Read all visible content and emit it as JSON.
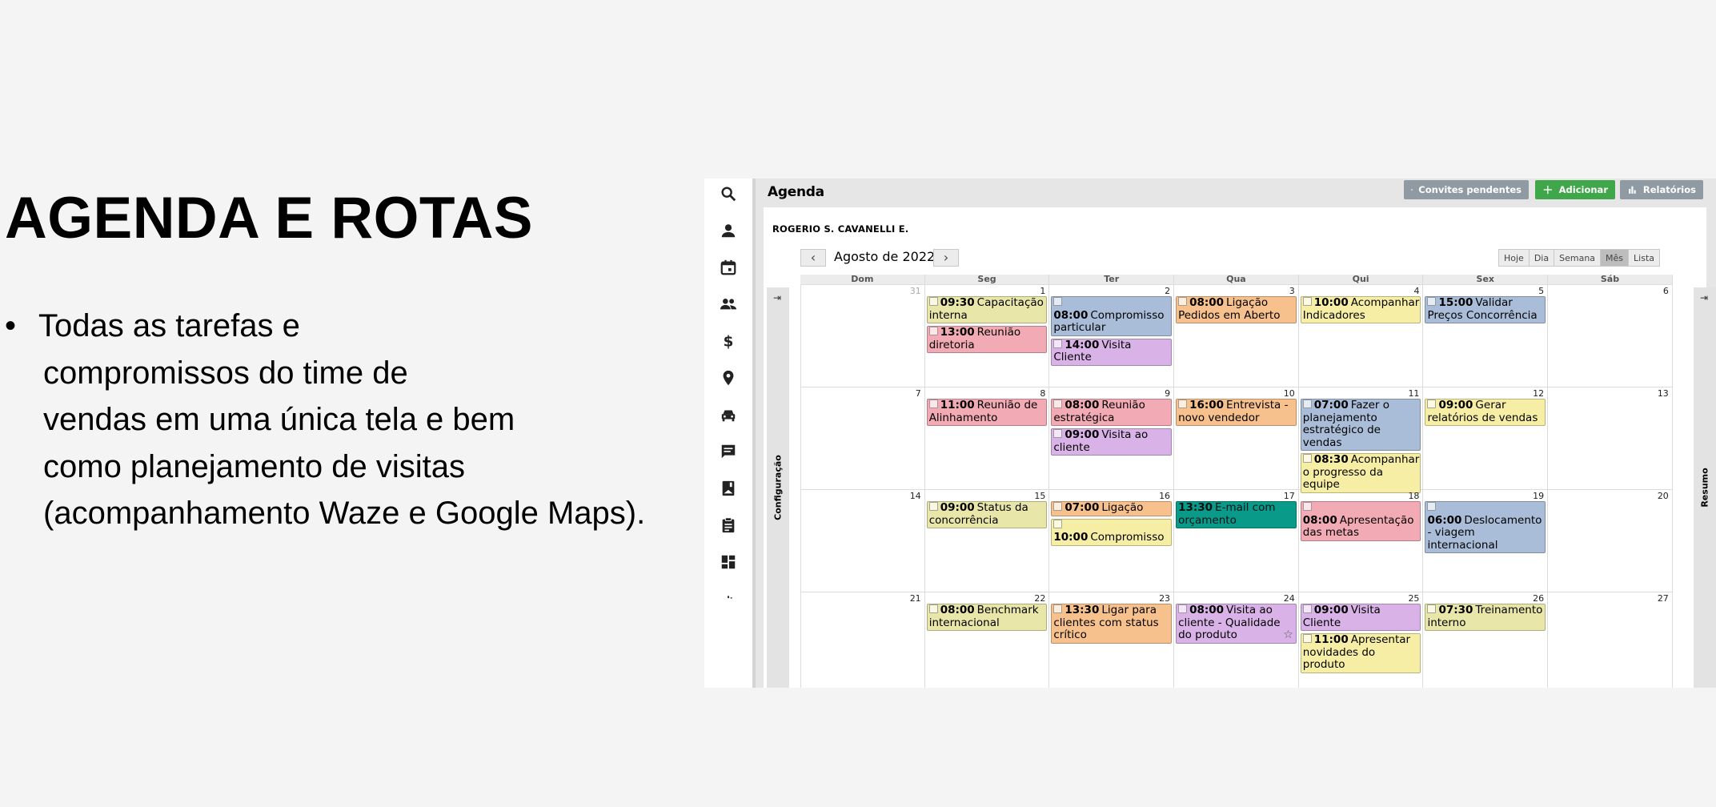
{
  "slide": {
    "title": "AGENDA E ROTAS",
    "bullet_marker": "•",
    "bullet_lines": [
      "Todas as tarefas e",
      "compromissos do time de",
      "vendas em uma única tela e bem",
      "como planejamento de visitas",
      "(acompanhamento Waze e Google Maps)."
    ]
  },
  "app": {
    "page_title": "Agenda",
    "buttons": {
      "invites": "Convites pendentes",
      "add": "Adicionar",
      "reports": "Relatórios"
    },
    "user_name": "ROGERIO S. CAVANELLI E.",
    "nav_prev": "‹",
    "nav_next": "›",
    "month_label": "Agosto de 2022",
    "views": [
      "Hoje",
      "Dia",
      "Semana",
      "Mês",
      "Lista"
    ],
    "active_view": "Mês",
    "left_panel_label": "Configuração",
    "right_panel_label": "Resumo",
    "sidebar_icons": [
      "search-icon",
      "user-icon",
      "calendar-icon",
      "team-icon",
      "dollar-icon",
      "map-pin-icon",
      "car-icon",
      "chat-icon",
      "contacts-book-icon",
      "clipboard-icon",
      "dashboard-icon",
      "more-icon"
    ],
    "colors": {
      "yellow": "#f7eea6",
      "olive": "#e8e6a8",
      "blue": "#a9bcd8",
      "pink": "#f2aab4",
      "purple": "#d9b3e8",
      "orange": "#f7c18e",
      "teal": "#0a9a8a",
      "green_button": "#3fa64a",
      "gray_button": "#8f9aa3"
    },
    "calendar": {
      "weekdays": [
        "Dom",
        "Seg",
        "Ter",
        "Qua",
        "Qui",
        "Sex",
        "Sáb"
      ],
      "weeks": [
        [
          {
            "day": "31",
            "muted": true,
            "events": []
          },
          {
            "day": "1",
            "events": [
              {
                "time": "09:30",
                "title": "Capacitação interna",
                "color": "olive"
              },
              {
                "time": "13:00",
                "title": "Reunião diretoria",
                "color": "pink"
              }
            ]
          },
          {
            "day": "2",
            "events": [
              {
                "time": "08:00",
                "title": "Compromisso particular",
                "color": "blue"
              },
              {
                "time": "14:00",
                "title": "Visita Cliente",
                "color": "purple"
              }
            ]
          },
          {
            "day": "3",
            "events": [
              {
                "time": "08:00",
                "title": "Ligação Pedidos em Aberto",
                "color": "orange"
              }
            ]
          },
          {
            "day": "4",
            "events": [
              {
                "time": "10:00",
                "title": "Acompanhar Indicadores",
                "color": "yellow"
              }
            ]
          },
          {
            "day": "5",
            "events": [
              {
                "time": "15:00",
                "title": "Validar Preços Concorrência",
                "color": "blue"
              }
            ]
          },
          {
            "day": "6",
            "events": []
          }
        ],
        [
          {
            "day": "7",
            "events": []
          },
          {
            "day": "8",
            "events": [
              {
                "time": "11:00",
                "title": "Reunião de Alinhamento",
                "color": "pink"
              }
            ]
          },
          {
            "day": "9",
            "events": [
              {
                "time": "08:00",
                "title": "Reunião estratégica",
                "color": "pink"
              },
              {
                "time": "09:00",
                "title": "Visita ao cliente",
                "color": "purple"
              }
            ]
          },
          {
            "day": "10",
            "events": [
              {
                "time": "16:00",
                "title": "Entrevista - novo vendedor",
                "color": "orange"
              }
            ]
          },
          {
            "day": "11",
            "events": [
              {
                "time": "07:00",
                "title": "Fazer o planejamento estratégico de vendas",
                "color": "blue"
              },
              {
                "time": "08:30",
                "title": "Acompanhar o progresso da equipe",
                "color": "yellow"
              }
            ]
          },
          {
            "day": "12",
            "events": [
              {
                "time": "09:00",
                "title": "Gerar relatórios de vendas",
                "color": "yellow"
              }
            ]
          },
          {
            "day": "13",
            "events": []
          }
        ],
        [
          {
            "day": "14",
            "events": []
          },
          {
            "day": "15",
            "events": [
              {
                "time": "09:00",
                "title": "Status da concorrência",
                "color": "olive"
              }
            ]
          },
          {
            "day": "16",
            "events": [
              {
                "time": "07:00",
                "title": "Ligação",
                "color": "orange"
              },
              {
                "time": "10:00",
                "title": "Compromisso",
                "color": "yellow"
              }
            ]
          },
          {
            "day": "17",
            "events": [
              {
                "time": "13:30",
                "title": "E-mail com orçamento",
                "color": "teal"
              }
            ]
          },
          {
            "day": "18",
            "events": [
              {
                "time": "08:00",
                "title": "Apresentação das metas",
                "color": "pink"
              }
            ]
          },
          {
            "day": "19",
            "events": [
              {
                "time": "06:00",
                "title": "Deslocamento - viagem internacional",
                "color": "blue"
              }
            ]
          },
          {
            "day": "20",
            "events": []
          }
        ],
        [
          {
            "day": "21",
            "events": []
          },
          {
            "day": "22",
            "events": [
              {
                "time": "08:00",
                "title": "Benchmark internacional",
                "color": "olive"
              }
            ]
          },
          {
            "day": "23",
            "events": [
              {
                "time": "13:30",
                "title": "Ligar para clientes com status crítico",
                "color": "orange"
              }
            ]
          },
          {
            "day": "24",
            "events": [
              {
                "time": "08:00",
                "title": "Visita ao cliente - Qualidade do produto",
                "color": "purple",
                "star": "☆"
              }
            ]
          },
          {
            "day": "25",
            "events": [
              {
                "time": "09:00",
                "title": "Visita Cliente",
                "color": "purple"
              },
              {
                "time": "11:00",
                "title": "Apresentar novidades do produto",
                "color": "yellow"
              }
            ]
          },
          {
            "day": "26",
            "events": [
              {
                "time": "07:30",
                "title": "Treinamento interno",
                "color": "olive"
              }
            ]
          },
          {
            "day": "27",
            "events": []
          }
        ]
      ]
    }
  }
}
